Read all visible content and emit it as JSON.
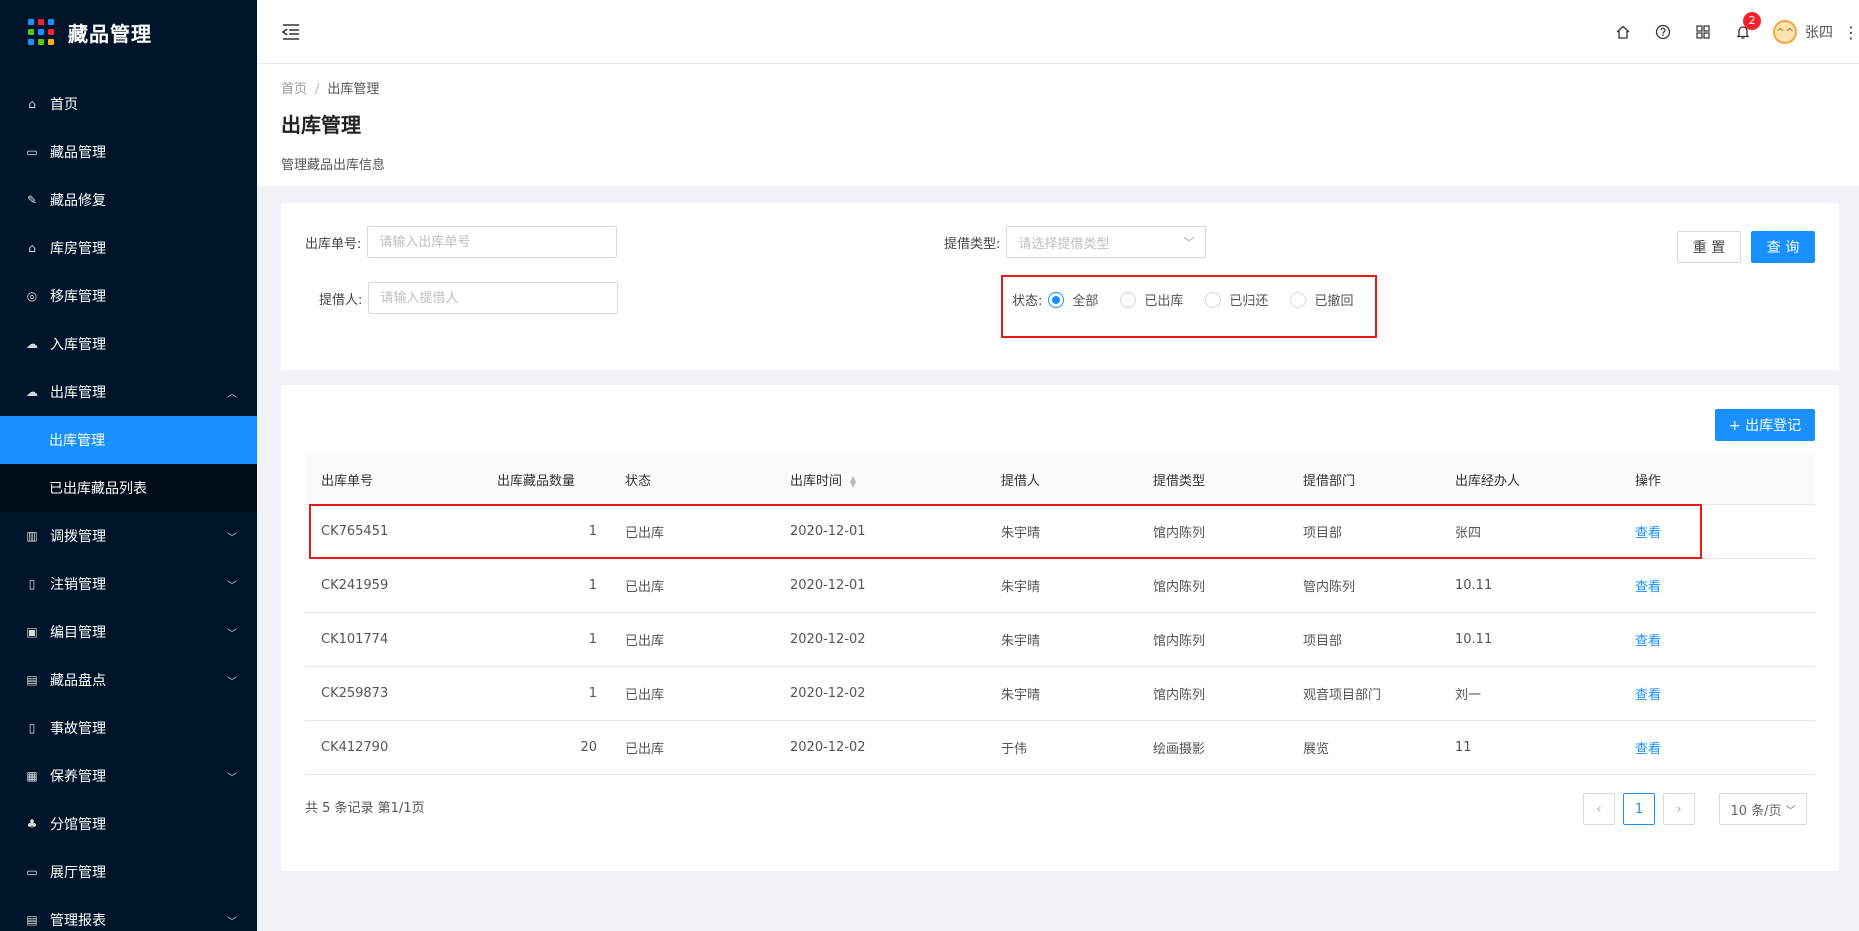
{
  "app": {
    "title": "藏品管理"
  },
  "colors": {
    "sidebar_bg": "#001529",
    "primary": "#1890ff",
    "highlight": "#e81b1b"
  },
  "sidebar": {
    "items": [
      {
        "label": "首页",
        "icon": "home-icon"
      },
      {
        "label": "藏品管理",
        "icon": "calendar-icon"
      },
      {
        "label": "藏品修复",
        "icon": "wrench-icon"
      },
      {
        "label": "库房管理",
        "icon": "warehouse-icon"
      },
      {
        "label": "移库管理",
        "icon": "transfer-icon"
      },
      {
        "label": "入库管理",
        "icon": "upload-icon"
      },
      {
        "label": "出库管理",
        "icon": "download-icon",
        "expanded": true
      },
      {
        "label": "调拨管理",
        "icon": "barcode-icon"
      },
      {
        "label": "注销管理",
        "icon": "file-icon"
      },
      {
        "label": "编目管理",
        "icon": "catalog-icon"
      },
      {
        "label": "藏品盘点",
        "icon": "inventory-icon"
      },
      {
        "label": "事故管理",
        "icon": "accident-icon"
      },
      {
        "label": "保养管理",
        "icon": "maintenance-icon"
      },
      {
        "label": "分馆管理",
        "icon": "branch-icon"
      },
      {
        "label": "展厅管理",
        "icon": "monitor-icon"
      },
      {
        "label": "管理报表",
        "icon": "report-icon"
      }
    ],
    "submenu": [
      {
        "label": "出库管理",
        "active": true
      },
      {
        "label": "已出库藏品列表",
        "active": false
      }
    ]
  },
  "header": {
    "notification_count": "2",
    "username": "张四",
    "avatar_text": "^^"
  },
  "breadcrumb": {
    "home": "首页",
    "current": "出库管理"
  },
  "page": {
    "title": "出库管理",
    "desc": "管理藏品出库信息"
  },
  "filter": {
    "order_no_label": "出库单号:",
    "order_no_placeholder": "请输入出库单号",
    "borrower_label": "提借人:",
    "borrower_placeholder": "请输入提借人",
    "type_label": "提借类型:",
    "type_placeholder": "请选择提借类型",
    "status_label": "状态:",
    "status_options": [
      "全部",
      "已出库",
      "已归还",
      "已撤回"
    ],
    "status_selected": "全部",
    "reset_label": "重 置",
    "search_label": "查 询"
  },
  "table": {
    "add_label": "+ 出库登记",
    "columns": [
      "出库单号",
      "出库藏品数量",
      "状态",
      "出库时间",
      "提借人",
      "提借类型",
      "提借部门",
      "出库经办人",
      "操作"
    ],
    "rows": [
      [
        "CK765451",
        "1",
        "已出库",
        "2020-12-01",
        "朱宇晴",
        "馆内陈列",
        "项目部",
        "张四",
        "查看"
      ],
      [
        "CK241959",
        "1",
        "已出库",
        "2020-12-01",
        "朱宇晴",
        "馆内陈列",
        "管内陈列",
        "10.11",
        "查看"
      ],
      [
        "CK101774",
        "1",
        "已出库",
        "2020-12-02",
        "朱宇晴",
        "馆内陈列",
        "项目部",
        "10.11",
        "查看"
      ],
      [
        "CK259873",
        "1",
        "已出库",
        "2020-12-02",
        "朱宇晴",
        "馆内陈列",
        "观音项目部门",
        "刘一",
        "查看"
      ],
      [
        "CK412790",
        "20",
        "已出库",
        "2020-12-02",
        "于伟",
        "绘画摄影",
        "展览",
        "11",
        "查看"
      ]
    ]
  },
  "pagination": {
    "summary": "共 5 条记录 第1/1页",
    "current_page": "1",
    "page_size": "10 条/页"
  }
}
